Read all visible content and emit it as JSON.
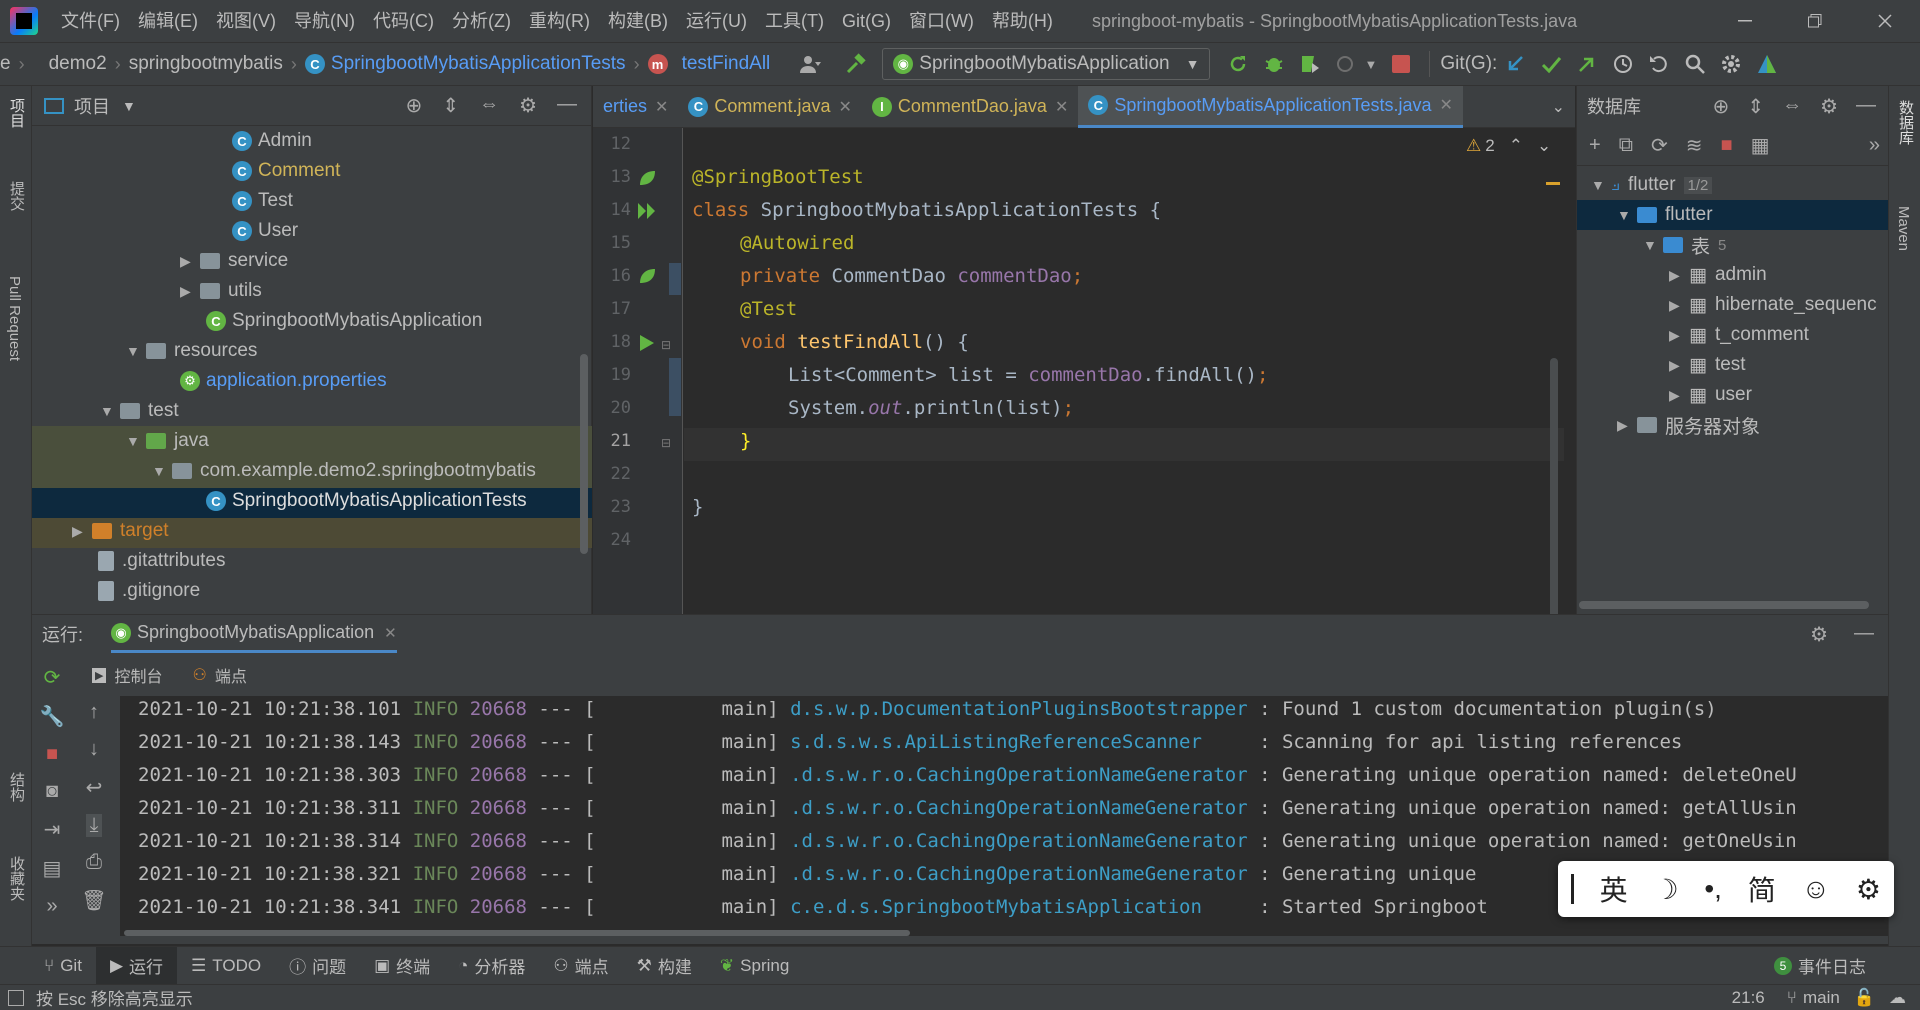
{
  "window": {
    "title": "springboot-mybatis - SpringbootMybatisApplicationTests.java"
  },
  "menu": [
    "文件(F)",
    "编辑(E)",
    "视图(V)",
    "导航(N)",
    "代码(C)",
    "分析(Z)",
    "重构(R)",
    "构建(B)",
    "运行(U)",
    "工具(T)",
    "Git(G)",
    "窗口(W)",
    "帮助(H)"
  ],
  "breadcrumb": [
    "e",
    "demo2",
    "springbootmybatis",
    "SpringbootMybatisApplicationTests",
    "testFindAll"
  ],
  "toolbar": {
    "run_config": "SpringbootMybatisApplication",
    "git_label": "Git(G):"
  },
  "left_strip": [
    "项目",
    "提交",
    "Pull Request",
    "结构",
    "收藏夹"
  ],
  "project": {
    "title": "项目",
    "tree": [
      {
        "label": "Admin",
        "type": "class"
      },
      {
        "label": "Comment",
        "type": "class"
      },
      {
        "label": "Test",
        "type": "class"
      },
      {
        "label": "User",
        "type": "class"
      },
      {
        "label": "service",
        "type": "folder"
      },
      {
        "label": "utils",
        "type": "folder"
      },
      {
        "label": "SpringbootMybatisApplication",
        "type": "app"
      },
      {
        "label": "resources",
        "type": "folder"
      },
      {
        "label": "application.properties",
        "type": "props"
      },
      {
        "label": "test",
        "type": "folder"
      },
      {
        "label": "java",
        "type": "folder"
      },
      {
        "label": "com.example.demo2.springbootmybatis",
        "type": "package"
      },
      {
        "label": "SpringbootMybatisApplicationTests",
        "type": "app"
      },
      {
        "label": "target",
        "type": "folder"
      },
      {
        "label": ".gitattributes",
        "type": "file"
      },
      {
        "label": ".gitignore",
        "type": "file"
      }
    ]
  },
  "editor": {
    "tabs": [
      "erties",
      "Comment.java",
      "CommentDao.java",
      "SpringbootMybatisApplicationTests.java"
    ],
    "warnings": "2",
    "line_numbers": [
      "12",
      "13",
      "14",
      "15",
      "16",
      "17",
      "18",
      "19",
      "20",
      "21",
      "22",
      "23",
      "24"
    ],
    "code": {
      "l13": "@SpringBootTest",
      "l14_kw": "class",
      "l14_rest": " SpringbootMybatisApplicationTests {",
      "l15": "@Autowired",
      "l16_kw": "private",
      "l16_type": " CommentDao ",
      "l16_field": "commentDao",
      "l16_end": ";",
      "l17": "@Test",
      "l18_kw": "void",
      "l18_fn": " testFindAll",
      "l18_rest": "() {",
      "l19_a": "List<Comment> list = ",
      "l19_b": "commentDao",
      "l19_c": ".findAll()",
      "l19_d": ";",
      "l20_a": "System.",
      "l20_b": "out",
      "l20_c": ".println(list)",
      "l20_d": ";",
      "l21": "}",
      "l23": "}"
    }
  },
  "database": {
    "title": "数据库",
    "tree": [
      {
        "label": "flutter",
        "badge": "1/2"
      },
      {
        "label": "flutter"
      },
      {
        "label": "表",
        "badge": "5"
      },
      {
        "label": "admin"
      },
      {
        "label": "hibernate_sequenc"
      },
      {
        "label": "t_comment"
      },
      {
        "label": "test"
      },
      {
        "label": "user"
      },
      {
        "label": "服务器对象"
      }
    ]
  },
  "right_strip": [
    "数据库",
    "Maven"
  ],
  "run": {
    "label": "运行:",
    "config_tab": "SpringbootMybatisApplication",
    "subtabs": [
      "控制台",
      "端点"
    ],
    "logs": [
      {
        "ts": "2021-10-21 10:21:38.101",
        "level": "INFO",
        "pid": "20668",
        "sep": " --- [",
        "thread": "           main]",
        "cls": " d.s.w.p.DocumentationPluginsBootstrapper",
        "msg": " : Found 1 custom documentation plugin(s)"
      },
      {
        "ts": "2021-10-21 10:21:38.143",
        "level": "INFO",
        "pid": "20668",
        "sep": " --- [",
        "thread": "           main]",
        "cls": " s.d.s.w.s.ApiListingReferenceScanner    ",
        "msg": " : Scanning for api listing references"
      },
      {
        "ts": "2021-10-21 10:21:38.303",
        "level": "INFO",
        "pid": "20668",
        "sep": " --- [",
        "thread": "           main]",
        "cls": " .d.s.w.r.o.CachingOperationNameGenerator",
        "msg": " : Generating unique operation named: deleteOneU"
      },
      {
        "ts": "2021-10-21 10:21:38.311",
        "level": "INFO",
        "pid": "20668",
        "sep": " --- [",
        "thread": "           main]",
        "cls": " .d.s.w.r.o.CachingOperationNameGenerator",
        "msg": " : Generating unique operation named: getAllUsin"
      },
      {
        "ts": "2021-10-21 10:21:38.314",
        "level": "INFO",
        "pid": "20668",
        "sep": " --- [",
        "thread": "           main]",
        "cls": " .d.s.w.r.o.CachingOperationNameGenerator",
        "msg": " : Generating unique operation named: getOneUsin"
      },
      {
        "ts": "2021-10-21 10:21:38.321",
        "level": "INFO",
        "pid": "20668",
        "sep": " --- [",
        "thread": "           main]",
        "cls": " .d.s.w.r.o.CachingOperationNameGenerator",
        "msg": " : Generating unique"
      },
      {
        "ts": "2021-10-21 10:21:38.341",
        "level": "INFO",
        "pid": "20668",
        "sep": " --- [",
        "thread": "           main]",
        "cls": " c.e.d.s.SpringbootMybatisApplication    ",
        "msg": " : Started Springboot"
      }
    ]
  },
  "bottom_tools": [
    "Git",
    "运行",
    "TODO",
    "问题",
    "终端",
    "分析器",
    "端点",
    "构建",
    "Spring"
  ],
  "event_log": {
    "count": "5",
    "label": "事件日志"
  },
  "status": {
    "message": "按 Esc 移除高亮显示",
    "position": "21:6",
    "branch": "main"
  },
  "ime": {
    "mode": "英",
    "script": "简"
  },
  "colors": {
    "accent": "#589df6",
    "keyword": "#cc7832",
    "annotation": "#bbb529",
    "field": "#9876aa",
    "function": "#ffc66d",
    "selection": "#0d293e"
  }
}
